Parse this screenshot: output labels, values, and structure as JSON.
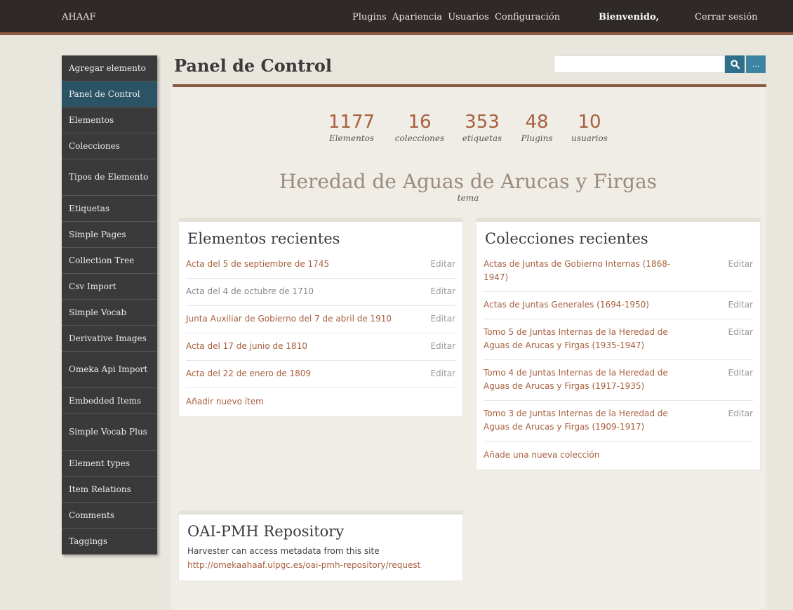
{
  "topbar": {
    "site_name": "AHAAF",
    "nav": [
      "Plugins",
      "Apariencia",
      "Usuarios",
      "Configuración"
    ],
    "welcome": "Bienvenido,",
    "logout": "Cerrar sesión"
  },
  "sidebar": {
    "items": [
      {
        "label": "Agregar elemento"
      },
      {
        "label": "Panel de Control",
        "active": true
      },
      {
        "label": "Elementos"
      },
      {
        "label": "Colecciones"
      },
      {
        "label": "Tipos de Elemento"
      },
      {
        "label": "Etiquetas"
      },
      {
        "label": "Simple Pages"
      },
      {
        "label": "Collection Tree"
      },
      {
        "label": "Csv Import"
      },
      {
        "label": "Simple Vocab"
      },
      {
        "label": "Derivative Images"
      },
      {
        "label": "Omeka Api Import"
      },
      {
        "label": "Embedded Items"
      },
      {
        "label": "Simple Vocab Plus"
      },
      {
        "label": "Element types"
      },
      {
        "label": "Item Relations"
      },
      {
        "label": "Comments"
      },
      {
        "label": "Taggings"
      }
    ]
  },
  "main": {
    "title": "Panel de Control",
    "search": {
      "value": "",
      "search_icon": "search-icon",
      "more_label": "..."
    },
    "stats": [
      {
        "value": "1177",
        "label": "Elementos"
      },
      {
        "value": "16",
        "label": "colecciones"
      },
      {
        "value": "353",
        "label": "etiquetas"
      },
      {
        "value": "48",
        "label": "Plugins"
      },
      {
        "value": "10",
        "label": "usuarios"
      }
    ],
    "site_title": "Heredad de Aguas de Arucas y Firgas",
    "site_subtitle": "tema"
  },
  "recent_items": {
    "heading": "Elementos recientes",
    "items": [
      {
        "title": "Acta del 5 de septiembre de 1745",
        "edit": "Editar"
      },
      {
        "title": "Acta del 4 de octubre de 1710",
        "edit": "Editar"
      },
      {
        "title": "Junta Auxiliar de Gobierno del 7 de abril de 1910",
        "edit": "Editar"
      },
      {
        "title": "Acta del 17 de junio de 1810",
        "edit": "Editar"
      },
      {
        "title": "Acta del 22 de enero de 1809",
        "edit": "Editar"
      }
    ],
    "add_label": "Añadir nuevo ítem"
  },
  "recent_collections": {
    "heading": "Colecciones recientes",
    "items": [
      {
        "title": "Actas de Juntas de Gobierno Internas (1868-1947)",
        "edit": "Editar"
      },
      {
        "title": "Actas de Juntas Generales (1694-1950)",
        "edit": "Editar"
      },
      {
        "title": "Tomo 5 de Juntas Internas de la Heredad de Aguas de Arucas y Firgas (1935-1947)",
        "edit": "Editar"
      },
      {
        "title": "Tomo 4 de Juntas Internas de la Heredad de Aguas de Arucas y Firgas (1917-1935)",
        "edit": "Editar"
      },
      {
        "title": "Tomo 3 de Juntas Internas de la Heredad de Aguas de Arucas y Firgas (1909-1917)",
        "edit": "Editar"
      }
    ],
    "add_label": "Añade una nueva colección"
  },
  "oai": {
    "heading": "OAI-PMH Repository",
    "text": "Harvester can access metadata from this site",
    "link": "http://omekaahaaf.ulpgc.es/oai-pmh-repository/request"
  },
  "colors": {
    "topbar_bg": "#2f2a27",
    "accent_rule": "#8c5a40",
    "link": "#a8603f",
    "sidebar_bg": "#3a3a3a",
    "sidebar_active": "#2a5366",
    "search_button": "#2e6f8a"
  }
}
